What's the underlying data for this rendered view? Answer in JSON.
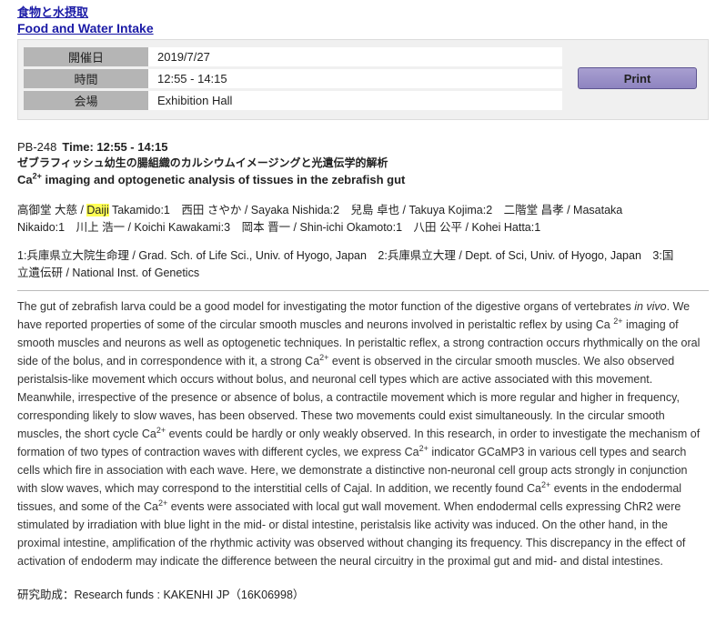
{
  "session": {
    "title_jp": "食物と水摂取",
    "title_en": "Food and Water Intake"
  },
  "info": {
    "rows": [
      {
        "label": "開催日",
        "value": "2019/7/27"
      },
      {
        "label": "時間",
        "value": "12:55 - 14:15"
      },
      {
        "label": "会場",
        "value": "Exhibition Hall"
      }
    ],
    "print_label": "Print"
  },
  "presentation": {
    "number": "PB-248",
    "time": "Time: 12:55 - 14:15",
    "title_jp": "ゼブラフィッシュ幼生の腸組織のカルシウムイメージングと光遺伝学的解析",
    "title_en_ca": "Ca",
    "title_en_sup": "2+",
    "title_en_rest": " imaging and optogenetic analysis of tissues in the zebrafish gut"
  },
  "authors": {
    "prefix": "高御堂 大慈 / ",
    "highlight": "Daiji",
    "rest_line1": " Takamido:1　西田 さやか / Sayaka Nishida:2　兒島 卓也 / Takuya Kojima:2　二階堂 昌孝 / Masataka",
    "rest_line2": "Nikaido:1　川上 浩一 / Koichi Kawakami:3　岡本 晋一 / Shin-ichi Okamoto:1　八田 公平 / Kohei Hatta:1"
  },
  "affiliations": {
    "line1": "1:兵庫県立大院生命理 / Grad. Sch. of Life Sci., Univ. of Hyogo, Japan　2:兵庫県立大理 / Dept. of Sci, Univ. of Hyogo, Japan　3:国",
    "line2": "立遺伝研 / National Inst. of Genetics"
  },
  "abstract": {
    "p1": "The gut of zebrafish larva could be a good model for investigating the motor function of the digestive organs of vertebrates ",
    "in_vivo": "in vivo",
    "p2": ". We have reported properties of some of the circular smooth muscles and neurons involved in peristaltic reflex by using Ca ",
    "sup": "2+",
    "p3": " imaging of smooth muscles and neurons as well as optogenetic techniques. In peristaltic reflex, a strong contraction occurs rhythmically on the oral side of the bolus, and in correspondence with it, a strong Ca",
    "p4": " event is observed in the circular smooth muscles. We also observed peristalsis-like movement which occurs without bolus, and neuronal cell types which are active associated with this movement. Meanwhile, irrespective of the presence or absence of bolus, a contractile movement which is more regular and higher in frequency, corresponding likely to slow waves, has been observed. These two movements could exist simultaneously. In the circular smooth muscles, the short cycle Ca",
    "p5": " events could be hardly or only weakly observed. In this research, in order to investigate the mechanism of formation of two types of contraction waves with different cycles, we express Ca",
    "p6": " indicator GCaMP3 in various cell types and search cells which fire in association with each wave. Here, we demonstrate a distinctive non-neuronal cell group acts strongly in conjunction with slow waves, which may correspond to the interstitial cells of Cajal. In addition, we recently found Ca",
    "p7": " events in the endodermal tissues, and some of the Ca",
    "p8": " events were associated with local gut wall movement. When endodermal cells expressing ChR2 were stimulated by irradiation with blue light in the mid- or distal intestine, peristalsis like activity was induced. On the other hand, in the proximal intestine, amplification of the rhythmic activity was observed without changing its frequency. This discrepancy in the effect of activation of endoderm may indicate the difference between the neural circuitry in the proximal gut and mid- and distal intestines."
  },
  "funds": "研究助成：Research funds : KAKENHI JP（16K06998）"
}
